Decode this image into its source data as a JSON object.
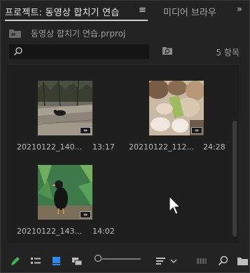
{
  "tabs": {
    "active_label": "프로젝트: 동영상 합치기 연습",
    "menu_symbol": "≡",
    "inactive_label": "미디어 브라우",
    "overflow_symbol": "»"
  },
  "project": {
    "filename": "동영상 합치기 연습.prproj"
  },
  "search": {
    "value": "",
    "placeholder": ""
  },
  "item_count": "5 항목",
  "clips": [
    {
      "name": "20210122_140...",
      "duration": "13:17",
      "scene": "zoo-enclosure"
    },
    {
      "name": "20210122_112...",
      "duration": "24:28",
      "scene": "feeding-alpacas"
    },
    {
      "name": "20210122_143...",
      "duration": "14:02",
      "scene": "black-bird"
    }
  ],
  "toolbar": {
    "icons": [
      "pencil-icon",
      "list-view-icon",
      "icon-view-icon",
      "freeform-view-icon",
      "zoom-slider",
      "sort-icon",
      "chevron-down-icon",
      "automate-to-sequence-icon",
      "find-icon",
      "new-bin-icon",
      "new-item-icon"
    ]
  },
  "colors": {
    "accent_green": "#3fb34f",
    "accent_blue": "#2d8ceb",
    "panel_bg": "#232323"
  }
}
